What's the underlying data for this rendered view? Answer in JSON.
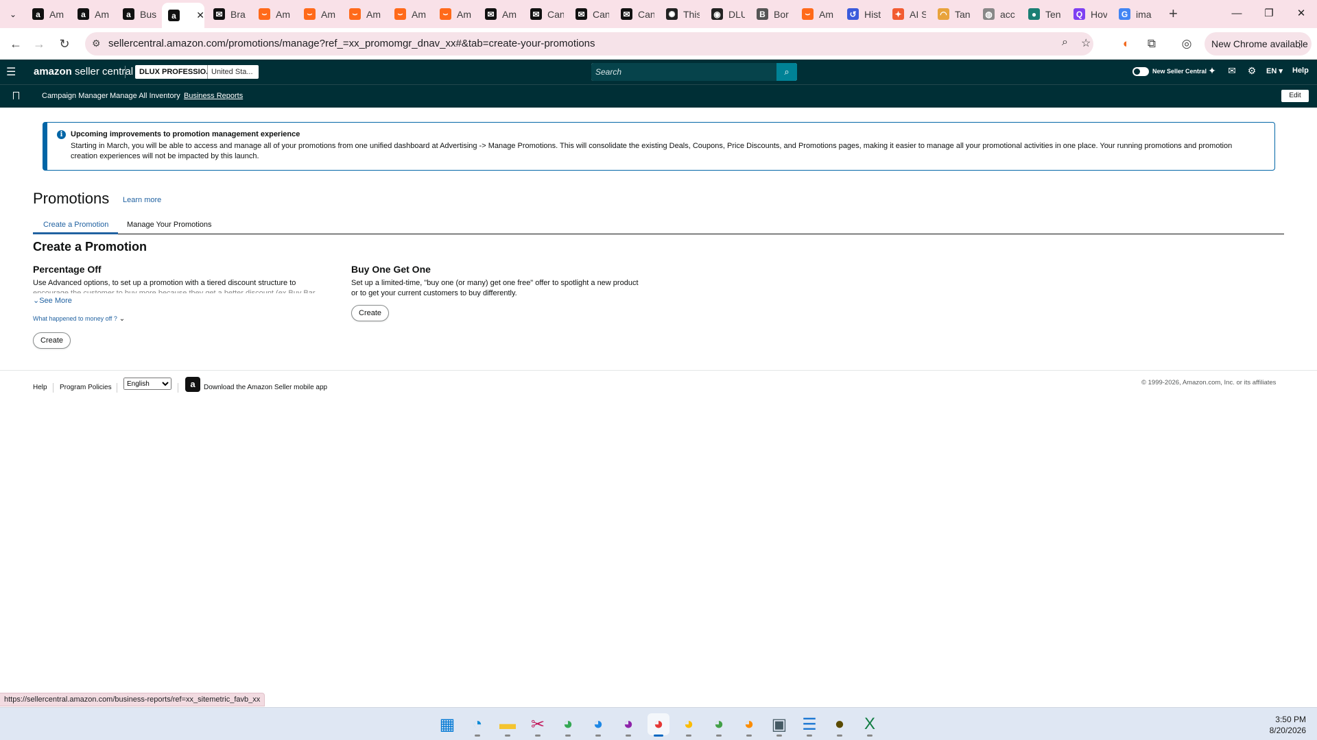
{
  "browser": {
    "tabs": [
      {
        "title": "Am",
        "favicon": "amazon-icon",
        "color": "#111111",
        "glyph": "a"
      },
      {
        "title": "Am",
        "favicon": "amazon-icon",
        "color": "#111111",
        "glyph": "a"
      },
      {
        "title": "Bus",
        "favicon": "amazon-icon",
        "color": "#111111",
        "glyph": "a"
      },
      {
        "title": "",
        "favicon": "amazon-icon",
        "color": "#111111",
        "glyph": "a",
        "active": true
      },
      {
        "title": "Bra",
        "favicon": "mail-icon",
        "color": "#111111",
        "glyph": "✉"
      },
      {
        "title": "Am",
        "favicon": "amazon-orange-icon",
        "color": "#ff6a1a",
        "glyph": "⌣"
      },
      {
        "title": "Am",
        "favicon": "amazon-orange-icon",
        "color": "#ff6a1a",
        "glyph": "⌣"
      },
      {
        "title": "Am",
        "favicon": "amazon-orange-icon",
        "color": "#ff6a1a",
        "glyph": "⌣"
      },
      {
        "title": "Am",
        "favicon": "amazon-orange-icon",
        "color": "#ff6a1a",
        "glyph": "⌣"
      },
      {
        "title": "Am",
        "favicon": "amazon-orange-icon",
        "color": "#ff6a1a",
        "glyph": "⌣"
      },
      {
        "title": "Am",
        "favicon": "mail-icon",
        "color": "#111111",
        "glyph": "✉"
      },
      {
        "title": "Can",
        "favicon": "mail-icon",
        "color": "#111111",
        "glyph": "✉"
      },
      {
        "title": "Can",
        "favicon": "mail-icon",
        "color": "#111111",
        "glyph": "✉"
      },
      {
        "title": "Can",
        "favicon": "mail-icon",
        "color": "#111111",
        "glyph": "✉"
      },
      {
        "title": "This",
        "favicon": "chatgpt-icon",
        "color": "#222222",
        "glyph": "✺"
      },
      {
        "title": "DLU",
        "favicon": "circle-logo-icon",
        "color": "#222222",
        "glyph": "◉"
      },
      {
        "title": "Bor",
        "favicon": "b-logo-icon",
        "color": "#555555",
        "glyph": "B"
      },
      {
        "title": "Am",
        "favicon": "amazon-orange-icon",
        "color": "#ff6a1a",
        "glyph": "⌣"
      },
      {
        "title": "Hist",
        "favicon": "history-icon",
        "color": "#3b5bdb",
        "glyph": "↺"
      },
      {
        "title": "AI S",
        "favicon": "ai-icon",
        "color": "#f25c32",
        "glyph": "✦"
      },
      {
        "title": "Tan",
        "favicon": "rainbow-icon",
        "color": "#e8a33c",
        "glyph": "◠"
      },
      {
        "title": "acc",
        "favicon": "globe-icon",
        "color": "#888888",
        "glyph": "◍"
      },
      {
        "title": "Ten",
        "favicon": "leaf-icon",
        "color": "#1a7f74",
        "glyph": "●"
      },
      {
        "title": "Hov",
        "favicon": "q-icon",
        "color": "#7e3ff2",
        "glyph": "Q"
      },
      {
        "title": "ima",
        "favicon": "google-icon",
        "color": "#4285f4",
        "glyph": "G"
      }
    ],
    "url": "sellercentral.amazon.com/promotions/manage?ref_=xx_promomgr_dnav_xx#&tab=create-your-promotions",
    "chrome_update_label": "New Chrome available",
    "status_url": "https://sellercentral.amazon.com/business-reports/ref=xx_sitemetric_favb_xx"
  },
  "seller_nav": {
    "logo_main": "amazon",
    "logo_sub": "seller central",
    "account_name": "DLUX PROFESSIO...",
    "marketplace": "United Sta...",
    "search_placeholder": "Search",
    "new_seller_central_label": "New Seller Central",
    "language": "EN",
    "help_label": "Help"
  },
  "bookmarks": {
    "items": [
      "Campaign Manager",
      "Manage All Inventory",
      "Business Reports"
    ],
    "edit_label": "Edit"
  },
  "banner": {
    "title": "Upcoming improvements to promotion management experience",
    "text": "Starting in March, you will be able to access and manage all of your promotions from one unified dashboard at Advertising -> Manage Promotions. This will consolidate the existing Deals, Coupons, Price Discounts, and Promotions pages, making it easier to manage all your promotional activities in one place. Your running promotions and promotion creation experiences will not be impacted by this launch."
  },
  "page": {
    "title": "Promotions",
    "learn_more": "Learn more",
    "tabs": [
      "Create a Promotion",
      "Manage Your Promotions"
    ],
    "section_title": "Create a Promotion"
  },
  "cards": {
    "percentage_off": {
      "title": "Percentage Off",
      "desc_line1": "Use Advanced options, to set up a promotion with a tiered discount structure to",
      "desc_line2": "encourage the customer to buy more because they get a better discount (ex Buy Bar",
      "see_more": "See More",
      "money_off": "What happened to money off ?",
      "button": "Create"
    },
    "bogo": {
      "title": "Buy One Get One",
      "desc_line1": "Set up a limited-time, \"buy one (or many) get one free\" offer to spotlight a new product",
      "desc_line2": "or to get your current customers to buy differently.",
      "button": "Create"
    }
  },
  "footer": {
    "help": "Help",
    "program_policies": "Program Policies",
    "language_selected": "English",
    "download_app": "Download the Amazon Seller mobile app",
    "copyright": "© 1999-2026, Amazon.com, Inc. or its affiliates"
  },
  "taskbar": {
    "time": "3:50 PM",
    "date": "8/20/2026",
    "apps": [
      {
        "name": "start-icon",
        "color": "#0078d4",
        "glyph": "▦"
      },
      {
        "name": "edge-icon",
        "color": "#0c8ad6",
        "glyph": "◔"
      },
      {
        "name": "file-explorer-icon",
        "color": "#f4c430",
        "glyph": "▬"
      },
      {
        "name": "snipping-tool-icon",
        "color": "#c2185b",
        "glyph": "✂"
      },
      {
        "name": "chrome-profile-icon",
        "color": "#34a853",
        "glyph": "◕"
      },
      {
        "name": "chrome-profile-icon",
        "color": "#1e88e5",
        "glyph": "◕"
      },
      {
        "name": "chrome-profile-icon",
        "color": "#8e24aa",
        "glyph": "◕"
      },
      {
        "name": "chrome-active-icon",
        "color": "#e53935",
        "glyph": "◕",
        "active": true
      },
      {
        "name": "chrome-icon",
        "color": "#fbbc05",
        "glyph": "◕"
      },
      {
        "name": "chrome-profile-icon",
        "color": "#43a047",
        "glyph": "◕"
      },
      {
        "name": "chrome-profile-icon",
        "color": "#fb8c00",
        "glyph": "◕"
      },
      {
        "name": "terminal-icon",
        "color": "#455a64",
        "glyph": "▣"
      },
      {
        "name": "notepad-icon",
        "color": "#1976d2",
        "glyph": "☰"
      },
      {
        "name": "chat-icon",
        "color": "#5a4a00",
        "glyph": "●"
      },
      {
        "name": "excel-icon",
        "color": "#107c41",
        "glyph": "X"
      }
    ]
  }
}
